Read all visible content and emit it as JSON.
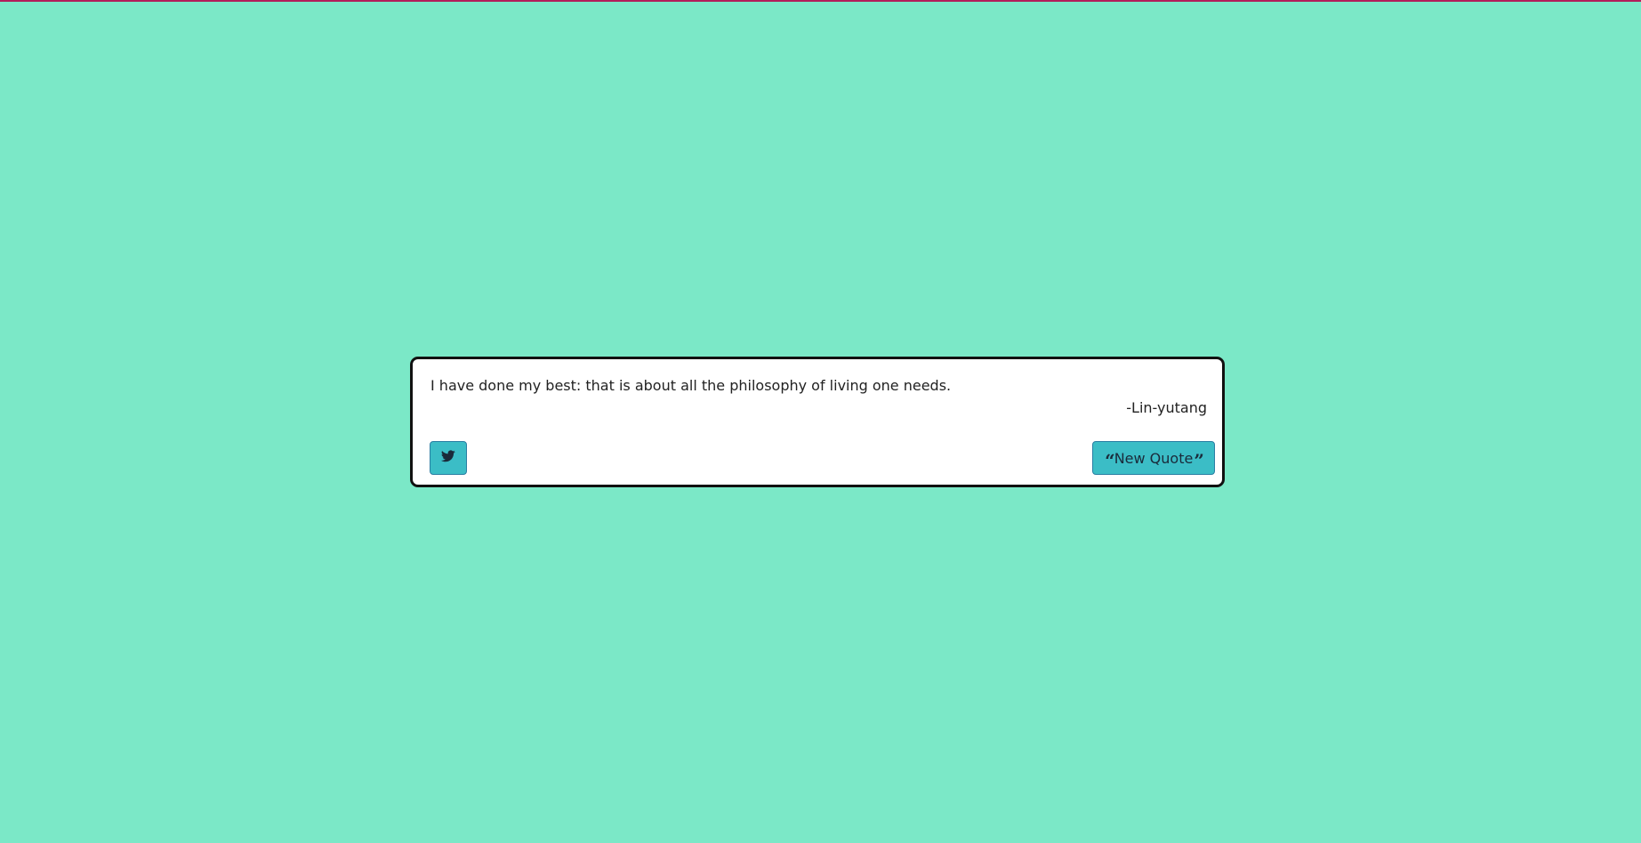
{
  "quote": {
    "text": "I have done my best: that is about all the philosophy of living one needs.",
    "author": "-Lin-yutang"
  },
  "buttons": {
    "tweet_icon": "twitter-icon",
    "new_quote_label": "New Quote",
    "open_quote_glyph": "“",
    "close_quote_glyph": "”"
  },
  "colors": {
    "background": "#7be8c7",
    "accent_top_line": "#b31d5b",
    "button": "#3bbdc6",
    "card": "#ffffff"
  }
}
